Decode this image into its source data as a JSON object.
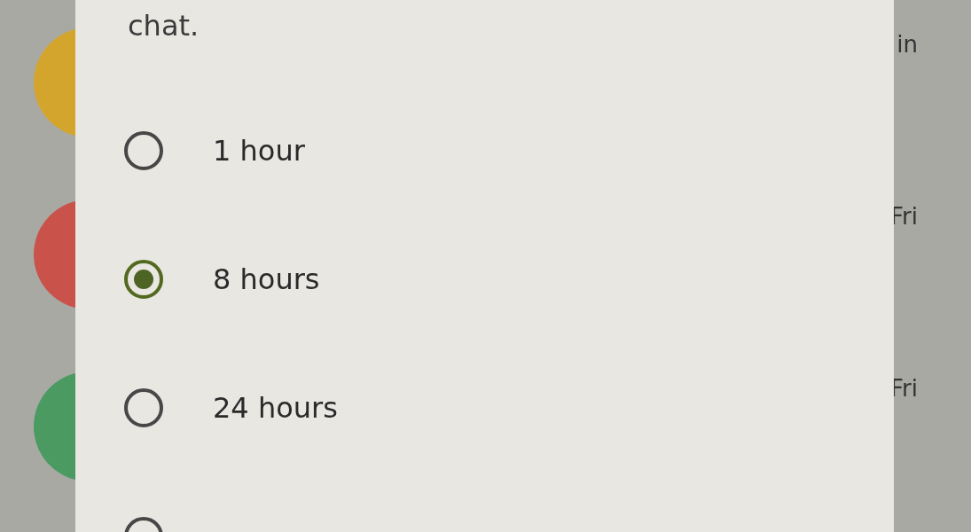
{
  "background_list": [
    {
      "color": "#d4a52c",
      "time": "in"
    },
    {
      "color": "#c9534a",
      "time": "Fri"
    },
    {
      "color": "#4a9a62",
      "time": "Fri"
    }
  ],
  "dialog": {
    "text": "chat.",
    "options": [
      {
        "label": "1 hour",
        "selected": false
      },
      {
        "label": "8 hours",
        "selected": true
      },
      {
        "label": "24 hours",
        "selected": false
      },
      {
        "selected": false
      }
    ]
  }
}
